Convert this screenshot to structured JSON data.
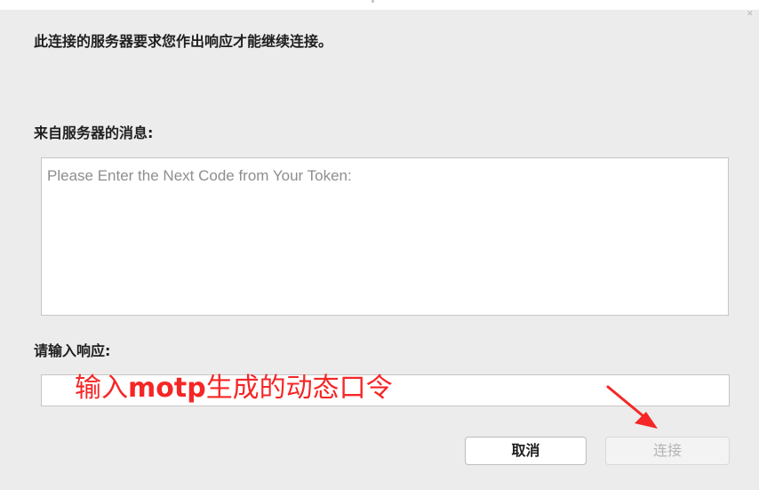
{
  "dialog": {
    "prompt": "此连接的服务器要求您作出响应才能继续连接。",
    "message_label": "来自服务器的消息:",
    "message_text": "Please Enter the Next Code from Your Token:",
    "response_label": "请输入响应:",
    "response_value": ""
  },
  "annotation": {
    "text_before": "输入",
    "text_bold": "motp",
    "text_after": "生成的动态口令",
    "color": "#f52626"
  },
  "buttons": {
    "cancel_label": "取消",
    "connect_label": "连接"
  },
  "icons": {
    "close": "close-icon",
    "arrow": "arrow-annotation-icon"
  }
}
